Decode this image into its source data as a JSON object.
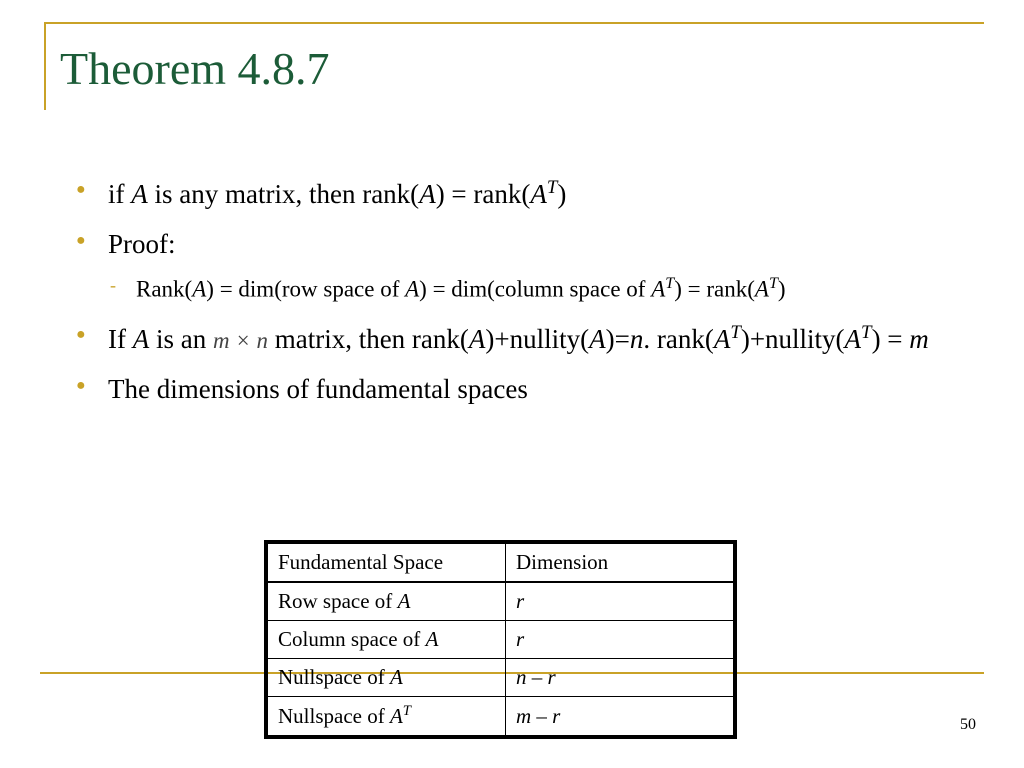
{
  "title": "Theorem 4.8.7",
  "bullets": {
    "b1_pre": "if ",
    "b1_A": "A",
    "b1_mid1": " is any matrix, then rank(",
    "b1_mid2": ") = rank(",
    "b1_T": "T",
    "b1_end": ")",
    "b2": "Proof:",
    "sub_pre": "Rank(",
    "sub_mid1": ") = dim(row space of ",
    "sub_mid2": ") = dim(column space of ",
    "sub_mid3": ") = rank(",
    "sub_end": ")",
    "b3_pre": "If ",
    "b3_mid1": " is an ",
    "b3_mxn": "m × n",
    "b3_mid2": " matrix, then rank(",
    "b3_mid3": ")+nullity(",
    "b3_mid4": ")=",
    "b3_n": "n",
    "b3_period": ". rank(",
    "b3_mid5": ")+nullity(",
    "b3_mid6": ") = ",
    "b3_m": "m",
    "b4": "The dimensions of fundamental spaces"
  },
  "table": {
    "h1": "Fundamental Space",
    "h2": "Dimension",
    "r1c1_pre": "Row space of ",
    "r1c2": "r",
    "r2c1_pre": "Column space of ",
    "r2c2": "r",
    "r3c1_pre": "Nullspace of ",
    "r3c2_pre": "n",
    "r3c2_mid": " – ",
    "r3c2_post": "r",
    "r4c1_pre": "Nullspace of ",
    "r4c2_pre": "m",
    "r4c2_mid": " – ",
    "r4c2_post": "r",
    "A": "A",
    "T": "T"
  },
  "page": "50"
}
